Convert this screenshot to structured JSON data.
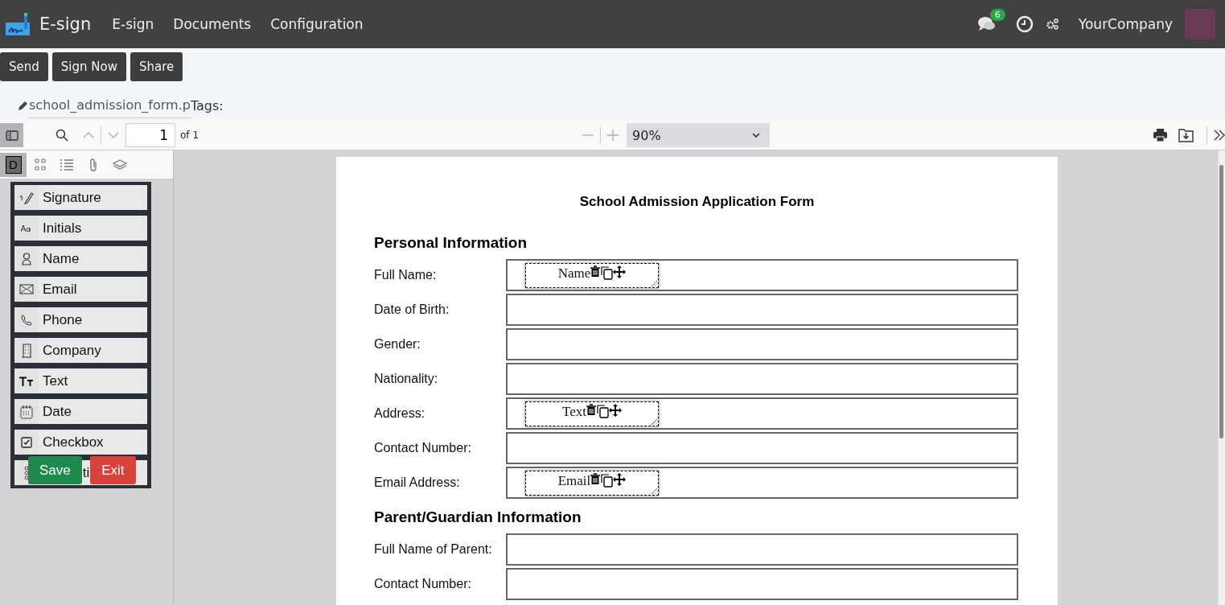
{
  "app": {
    "title": "E-sign"
  },
  "menu": [
    {
      "label": "E-sign"
    },
    {
      "label": "Documents"
    },
    {
      "label": "Configuration"
    }
  ],
  "systray": {
    "messages_count": "6",
    "company": "YourCompany"
  },
  "actions": [
    {
      "label": "Send"
    },
    {
      "label": "Sign Now"
    },
    {
      "label": "Share"
    }
  ],
  "document": {
    "filename": "school_admission_form.p",
    "tags_label": "Tags:"
  },
  "viewer": {
    "page": "1",
    "page_count": "of 1",
    "zoom": "90%"
  },
  "sidebar_tabs": [
    {
      "kind": "letter",
      "label": "D",
      "selected": true
    },
    {
      "kind": "thumbnails",
      "selected": false
    },
    {
      "kind": "list",
      "selected": false
    },
    {
      "kind": "attachment",
      "selected": false
    },
    {
      "kind": "layers",
      "selected": false
    }
  ],
  "fields": [
    {
      "kind": "signature",
      "label": "Signature"
    },
    {
      "kind": "initials",
      "label": "Initials"
    },
    {
      "kind": "name",
      "label": "Name"
    },
    {
      "kind": "email",
      "label": "Email"
    },
    {
      "kind": "phone",
      "label": "Phone"
    },
    {
      "kind": "company",
      "label": "Company"
    },
    {
      "kind": "text",
      "label": "Text"
    },
    {
      "kind": "date",
      "label": "Date"
    },
    {
      "kind": "checkbox",
      "label": "Checkbox"
    },
    {
      "kind": "selection",
      "label": "ti"
    }
  ],
  "panel_buttons": [
    {
      "kind": "save",
      "label": "Save"
    },
    {
      "kind": "exit",
      "label": "Exit"
    }
  ],
  "form": {
    "title": "School Admission Application Form",
    "sections": [
      {
        "heading": "Personal Information",
        "rows": [
          {
            "label": "Full Name:",
            "placed_field": "Name"
          },
          {
            "label": "Date of Birth:"
          },
          {
            "label": "Gender:"
          },
          {
            "label": "Nationality:"
          },
          {
            "label": "Address:",
            "placed_field": "Text"
          },
          {
            "label": "Contact Number:"
          },
          {
            "label": "Email Address:",
            "placed_field": "Email"
          }
        ]
      },
      {
        "heading": "Parent/Guardian Information",
        "rows": [
          {
            "label": "Full Name of Parent:"
          },
          {
            "label": "Contact Number:"
          }
        ]
      }
    ]
  }
}
